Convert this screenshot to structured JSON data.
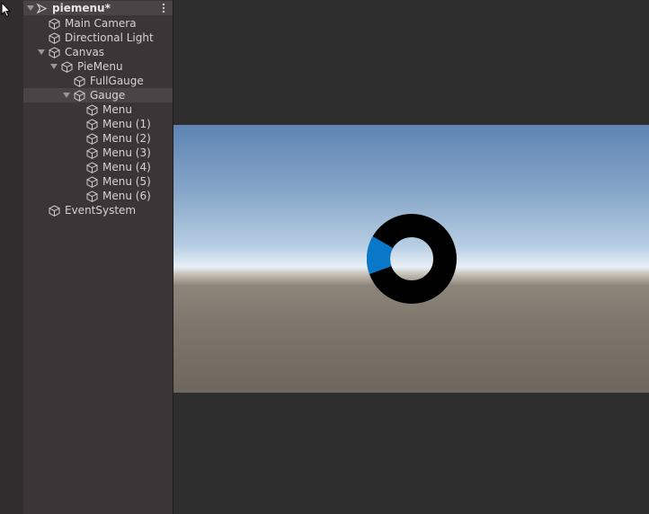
{
  "hierarchy": {
    "scene_name": "piemenu*",
    "items": [
      {
        "label": "Main Camera"
      },
      {
        "label": "Directional Light"
      },
      {
        "label": "Canvas"
      },
      {
        "label": "PieMenu"
      },
      {
        "label": "FullGauge"
      },
      {
        "label": "Gauge"
      },
      {
        "label": "Menu"
      },
      {
        "label": "Menu (1)"
      },
      {
        "label": "Menu (2)"
      },
      {
        "label": "Menu (3)"
      },
      {
        "label": "Menu (4)"
      },
      {
        "label": "Menu (5)"
      },
      {
        "label": "Menu (6)"
      },
      {
        "label": "EventSystem"
      }
    ]
  },
  "game_view": {
    "gauge": {
      "ring_color": "#000000",
      "fill_color": "#0a78c8",
      "fill_start_deg": 250,
      "fill_end_deg": 300
    }
  },
  "colors": {
    "panel": "#3b3538",
    "selected_row": "#4a4447",
    "text": "#d6d2d4"
  }
}
